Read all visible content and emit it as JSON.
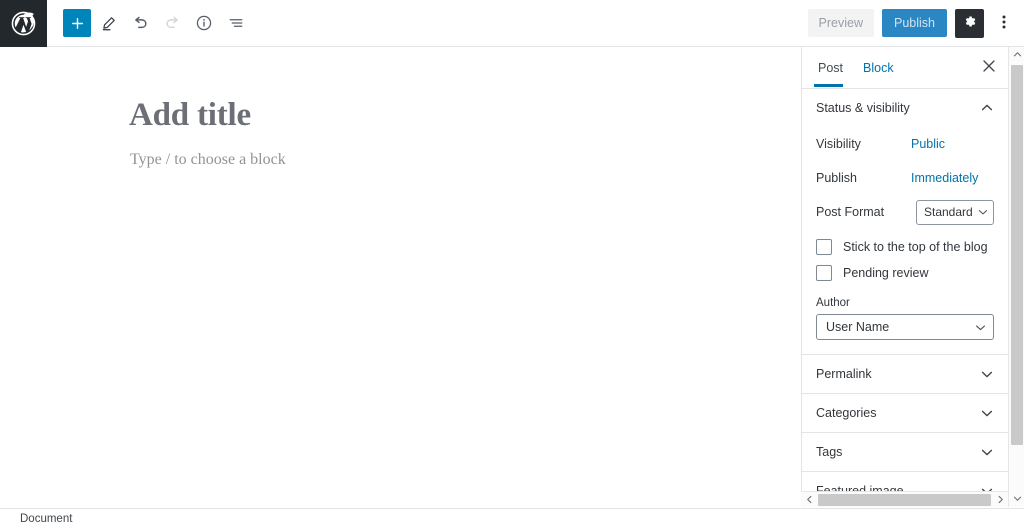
{
  "topbar": {
    "logo_icon": "wordpress-logo-icon",
    "tools": [
      {
        "name": "add-block-button",
        "icon": "plus-icon",
        "label": "Add block",
        "state": "primary"
      },
      {
        "name": "edit-mode-button",
        "icon": "pencil-icon",
        "label": "Tools",
        "state": "normal"
      },
      {
        "name": "undo-button",
        "icon": "undo-icon",
        "label": "Undo",
        "state": "normal"
      },
      {
        "name": "redo-button",
        "icon": "redo-icon",
        "label": "Redo",
        "state": "disabled"
      },
      {
        "name": "details-button",
        "icon": "info-icon",
        "label": "Details",
        "state": "normal"
      },
      {
        "name": "list-view-button",
        "icon": "list-view-icon",
        "label": "List view",
        "state": "normal"
      }
    ],
    "preview_label": "Preview",
    "publish_label": "Publish",
    "settings_icon": "gear-icon",
    "more_icon": "kebab-menu-icon",
    "accent_blue": "#0085ba",
    "publish_blue": "#2b87c4",
    "logo_bg": "#23282d"
  },
  "editor": {
    "title_placeholder": "Add title",
    "body_placeholder": "Type / to choose a block"
  },
  "sidebar": {
    "tabs": [
      {
        "label": "Post",
        "active": true
      },
      {
        "label": "Block",
        "active": false
      }
    ],
    "close_icon": "close-icon",
    "panels": [
      {
        "title": "Status & visibility",
        "expanded": true
      },
      {
        "title": "Permalink",
        "expanded": false
      },
      {
        "title": "Categories",
        "expanded": false
      },
      {
        "title": "Tags",
        "expanded": false
      },
      {
        "title": "Featured image",
        "expanded": false
      }
    ],
    "status_visibility": {
      "visibility_label": "Visibility",
      "visibility_value": "Public",
      "publish_label": "Publish",
      "publish_value": "Immediately",
      "post_format_label": "Post Format",
      "post_format_value": "Standard",
      "post_format_options": [
        "Standard"
      ],
      "sticky_label": "Stick to the top of the blog",
      "sticky_checked": false,
      "pending_label": "Pending review",
      "pending_checked": false,
      "author_label": "Author",
      "author_value": "User Name",
      "author_options": [
        "User Name"
      ]
    },
    "link_color": "#0073aa"
  },
  "statusbar": {
    "document_label": "Document"
  }
}
